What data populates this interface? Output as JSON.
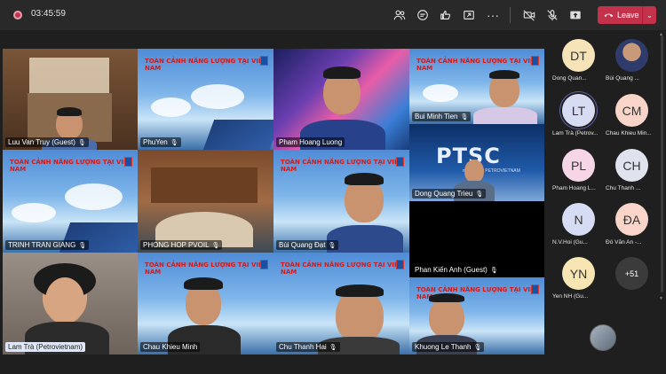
{
  "topbar": {
    "timer": "03:45:59",
    "leave_label": "Leave",
    "icons": [
      "people-icon",
      "chat-icon",
      "react-icon",
      "share-tray-icon",
      "more-icon",
      "camera-off-icon",
      "mic-off-icon",
      "share-icon"
    ]
  },
  "banner_title": "TOÀN CẢNH NĂNG LƯỢNG TẠI VIỆT NAM",
  "ptsc": {
    "logo_text": "PTSC",
    "sub": "member of PETROVIETNAM"
  },
  "tiles": [
    {
      "name": "Luu Van Truy (Guest)"
    },
    {
      "name": "PhuYen"
    },
    {
      "name": "Pham Hoang Luong"
    },
    {
      "name": "Bui Minh Tien"
    },
    {
      "name": "TRINH TRAN GIANG"
    },
    {
      "name": "PHONG HOP PVOIL"
    },
    {
      "name": "Bùi Quang Đạt"
    },
    {
      "name": "Dong Quang Trieu"
    },
    {
      "name": "Phan Kiến Anh (Guest)"
    },
    {
      "name": "Lam Trà (Petrovietnam)"
    },
    {
      "name": "Chau Khieu Minh"
    },
    {
      "name": "Chu Thanh Hai"
    },
    {
      "name": "Khuong Le Thanh"
    }
  ],
  "roster": [
    {
      "initials": "DT",
      "name": "Dong Quan...",
      "color": "#f7e3b8"
    },
    {
      "initials": "",
      "name": "Bùi Quang ...",
      "color": "#7a6a5e"
    },
    {
      "initials": "LT",
      "name": "Lam Trà (Petrov...",
      "color": "#d8dcf2"
    },
    {
      "initials": "CM",
      "name": "Chau Khieu Min...",
      "color": "#f8d5c8"
    },
    {
      "initials": "PL",
      "name": "Pham Hoang L...",
      "color": "#f6d6e6"
    },
    {
      "initials": "CH",
      "name": "Chu Thanh ...",
      "color": "#dfe3ee"
    },
    {
      "initials": "N",
      "name": "N.V.Hoi (Gu...",
      "color": "#d6dcf4"
    },
    {
      "initials": "ĐA",
      "name": "Đỗ Văn An -...",
      "color": "#f8d5c8"
    },
    {
      "initials": "YN",
      "name": "Yen NH (Gu...",
      "color": "#f7e6b4"
    }
  ],
  "more_count": "+51"
}
